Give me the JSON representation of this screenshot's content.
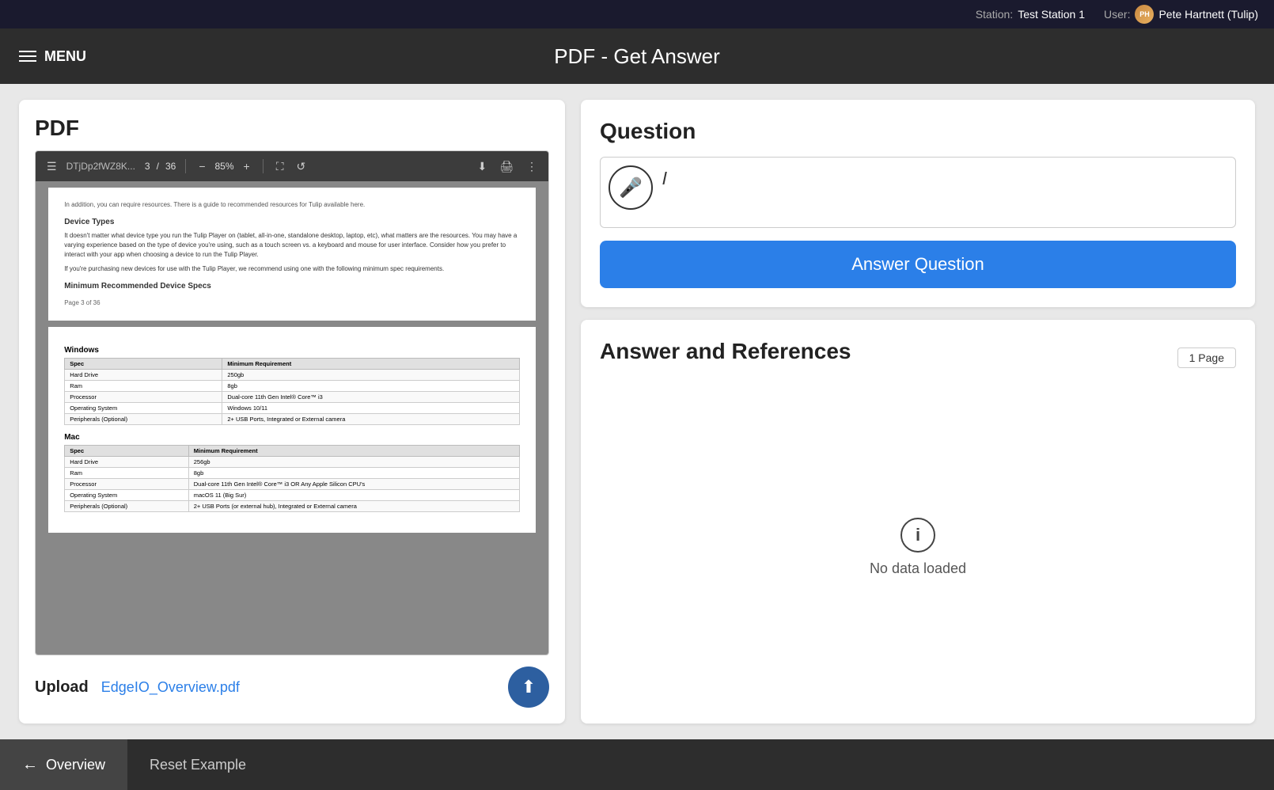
{
  "topbar": {
    "station_label": "Station:",
    "station_value": "Test Station 1",
    "user_label": "User:",
    "user_name": "Pete Hartnett (Tulip)"
  },
  "header": {
    "menu_label": "MENU",
    "page_title": "PDF - Get Answer"
  },
  "pdf_panel": {
    "title": "PDF",
    "toolbar": {
      "filename": "DTjDp2fWZ8K...",
      "page_current": "3",
      "page_total": "36",
      "zoom": "85%",
      "page_separator": "/"
    },
    "page1": {
      "intro_text": "In addition, you can require resources. There is a guide to recommended resources for Tulip available here.",
      "section_title": "Device Types",
      "body1": "It doesn't matter what device type you run the Tulip Player on (tablet, all-in-one, standalone desktop, laptop, etc), what matters are the resources. You may have a varying experience based on the type of device you're using, such as a touch screen vs. a keyboard and mouse for user interface. Consider how you prefer to interact with your app when choosing a device to run the Tulip Player.",
      "body2": "If you're purchasing new devices for use with the Tulip Player, we recommend using one with the following minimum spec requirements.",
      "section_title2": "Minimum Recommended Device Specs",
      "page_num": "Page 3 of 36"
    },
    "page2": {
      "subsection1": "Windows",
      "windows_headers": [
        "Spec",
        "Minimum Requirement"
      ],
      "windows_rows": [
        [
          "Hard Drive",
          "250gb"
        ],
        [
          "Ram",
          "8gb"
        ],
        [
          "Processor",
          "Dual-core 11th Gen Intel® Core™ i3"
        ],
        [
          "Operating System",
          "Windows 10/11"
        ],
        [
          "Peripherals (Optional)",
          "2+ USB Ports, Integrated or External camera"
        ]
      ],
      "subsection2": "Mac",
      "mac_headers": [
        "Spec",
        "Minimum Requirement"
      ],
      "mac_rows": [
        [
          "Hard Drive",
          "256gb"
        ],
        [
          "Ram",
          "8gb"
        ],
        [
          "Processor",
          "Dual-core 11th Gen Intel® Core™ i3 OR Any Apple Silicon CPU's"
        ],
        [
          "Operating System",
          "macOS 11 (Big Sur)"
        ],
        [
          "Peripherals (Optional)",
          "2+ USB Ports (or external hub), Integrated or External camera"
        ]
      ]
    },
    "upload_label": "Upload",
    "upload_filename": "EdgeIO_Overview.pdf"
  },
  "question_card": {
    "title": "Question",
    "input_placeholder": "",
    "answer_btn_label": "Answer Question"
  },
  "answer_card": {
    "title": "Answer and References",
    "page_badge": "1 Page",
    "no_data_text": "No data loaded"
  },
  "bottombar": {
    "overview_label": "Overview",
    "reset_label": "Reset Example"
  },
  "icons": {
    "hamburger": "☰",
    "mic": "🎤",
    "upload": "⬆",
    "back_arrow": "←",
    "info": "i"
  }
}
